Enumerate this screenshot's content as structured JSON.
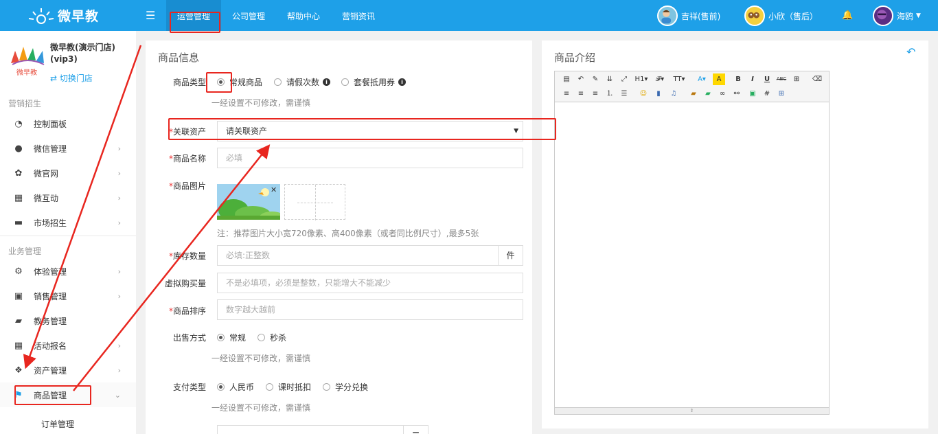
{
  "topbar": {
    "brand": "微早教",
    "nav": [
      "运营管理",
      "公司管理",
      "帮助中心",
      "营销资讯"
    ],
    "users": [
      "吉祥(售前)",
      "小欣（售后）",
      "海鸥"
    ]
  },
  "sidebar": {
    "store_name": "微早教(演示门店)(vip3)",
    "store_logo_text": "微早教",
    "switch_store": "切换门店",
    "section1": "营销招生",
    "section2": "业务管理",
    "items": [
      {
        "label": "控制面板",
        "icon": "dashboard-icon"
      },
      {
        "label": "微信管理",
        "icon": "wechat-icon"
      },
      {
        "label": "微官网",
        "icon": "paw-icon"
      },
      {
        "label": "微互动",
        "icon": "grid-icon"
      },
      {
        "label": "市场招生",
        "icon": "cart-icon"
      },
      {
        "label": "体验管理",
        "icon": "gears-icon"
      },
      {
        "label": "销售管理",
        "icon": "money-icon"
      },
      {
        "label": "教务管理",
        "icon": "book-icon"
      },
      {
        "label": "活动报名",
        "icon": "table-icon"
      },
      {
        "label": "资产管理",
        "icon": "cubes-icon"
      },
      {
        "label": "商品管理",
        "icon": "flag-icon"
      }
    ],
    "sub_item": "订单管理"
  },
  "form": {
    "title": "商品信息",
    "type_label": "商品类型",
    "type_options": [
      "常规商品",
      "请假次数",
      "套餐抵用券"
    ],
    "type_hint": "一经设置不可修改，需谨慎",
    "asset_label": "关联资产",
    "asset_placeholder": "请关联资产",
    "name_label": "商品名称",
    "name_placeholder": "必填",
    "image_label": "商品图片",
    "image_hint": "注：推荐图片大小宽720像素、高400像素（或者同比例尺寸）,最多5张",
    "stock_label": "库存数量",
    "stock_placeholder": "必填:正整数",
    "stock_unit": "件",
    "virtual_label": "虚拟购买量",
    "virtual_placeholder": "不是必填项，必须是整数，只能增大不能减少",
    "sort_label": "商品排序",
    "sort_placeholder": "数字越大越前",
    "sale_label": "出售方式",
    "sale_options": [
      "常规",
      "秒杀"
    ],
    "sale_hint": "一经设置不可修改，需谨慎",
    "pay_label": "支付类型",
    "pay_options": [
      "人民币",
      "课时抵扣",
      "学分兑换"
    ],
    "pay_hint": "一经设置不可修改，需谨慎"
  },
  "editor": {
    "title": "商品介绍",
    "tools_row1": [
      "source",
      "undo",
      "clear",
      "insert",
      "fullscreen",
      "H1",
      "F",
      "TT",
      "A",
      "A",
      "B",
      "I",
      "U",
      "ABC",
      "table",
      "eraser"
    ],
    "tools_row2": [
      "left",
      "center",
      "right",
      "ol",
      "ul",
      "emoji",
      "file",
      "music",
      "image",
      "image2",
      "link",
      "unlink",
      "picture",
      "grid",
      "table2"
    ]
  },
  "colors": {
    "primary": "#1ea0e8",
    "annotation": "#e8261f"
  }
}
